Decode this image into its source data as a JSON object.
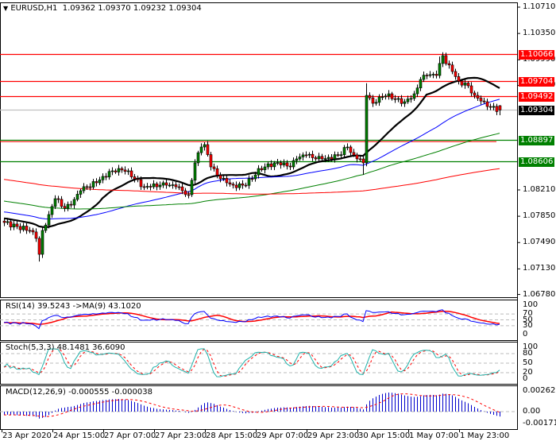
{
  "header": {
    "arrow": "▼",
    "symbol": "EURUSD,H1",
    "open": "1.09362",
    "high": "1.09370",
    "low": "1.09232",
    "close": "1.09304"
  },
  "chart_data": {
    "type": "candlestick",
    "symbol": "EURUSD",
    "timeframe": "H1",
    "last_bar": {
      "open": 1.09362,
      "high": 1.0937,
      "low": 1.09232,
      "close": 1.09304
    },
    "close_keypoints": [
      [
        0,
        1.07764
      ],
      [
        4,
        1.0771
      ],
      [
        8,
        1.07656
      ],
      [
        10,
        1.07547
      ],
      [
        11,
        1.07329
      ],
      [
        12,
        1.07656
      ],
      [
        14,
        1.07873
      ],
      [
        16,
        1.0809
      ],
      [
        19,
        1.0796
      ],
      [
        21,
        1.08003
      ],
      [
        24,
        1.08199
      ],
      [
        26,
        1.08253
      ],
      [
        29,
        1.08308
      ],
      [
        31,
        1.08395
      ],
      [
        34,
        1.08471
      ],
      [
        36,
        1.08503
      ],
      [
        39,
        1.08471
      ],
      [
        41,
        1.08362
      ],
      [
        44,
        1.08253
      ],
      [
        46,
        1.08253
      ],
      [
        49,
        1.08275
      ],
      [
        51,
        1.08275
      ],
      [
        54,
        1.08253
      ],
      [
        56,
        1.08199
      ],
      [
        58,
        1.08145
      ],
      [
        60,
        1.0858
      ],
      [
        62,
        1.08797
      ],
      [
        63,
        1.0883
      ],
      [
        65,
        1.08525
      ],
      [
        68,
        1.08362
      ],
      [
        70,
        1.08308
      ],
      [
        72,
        1.08275
      ],
      [
        75,
        1.08275
      ],
      [
        78,
        1.08362
      ],
      [
        80,
        1.08503
      ],
      [
        82,
        1.08525
      ],
      [
        85,
        1.0858
      ],
      [
        88,
        1.0858
      ],
      [
        90,
        1.08525
      ],
      [
        92,
        1.08634
      ],
      [
        95,
        1.08688
      ],
      [
        98,
        1.08634
      ],
      [
        100,
        1.08634
      ],
      [
        102,
        1.08656
      ],
      [
        105,
        1.08688
      ],
      [
        108,
        1.08797
      ],
      [
        110,
        1.08688
      ],
      [
        112,
        1.08634
      ],
      [
        113,
        1.0858
      ],
      [
        114,
        1.09503
      ],
      [
        116,
        1.09395
      ],
      [
        118,
        1.09482
      ],
      [
        121,
        1.09525
      ],
      [
        123,
        1.09449
      ],
      [
        126,
        1.09416
      ],
      [
        129,
        1.09525
      ],
      [
        131,
        1.09721
      ],
      [
        133,
        1.09775
      ],
      [
        136,
        1.09775
      ],
      [
        138,
        1.10047
      ],
      [
        139,
        1.09938
      ],
      [
        141,
        1.0983
      ],
      [
        143,
        1.09699
      ],
      [
        146,
        1.09634
      ],
      [
        148,
        1.09503
      ],
      [
        151,
        1.09416
      ],
      [
        153,
        1.0934
      ],
      [
        156,
        1.09304
      ]
    ],
    "moving_averages": [
      {
        "name": "MA20",
        "period": 20,
        "color": "#000000"
      },
      {
        "name": "MA50",
        "period": 50,
        "color": "#0000ff"
      },
      {
        "name": "MA100",
        "period": 100,
        "color": "#008000"
      },
      {
        "name": "MA200",
        "period": 200,
        "color": "#ff0000"
      }
    ],
    "levels": [
      {
        "label": "1.10066",
        "value": 1.10066,
        "color": "#ff0000"
      },
      {
        "label": "1.09704",
        "value": 1.09704,
        "color": "#ff0000"
      },
      {
        "label": "1.09492",
        "value": 1.09492,
        "color": "#ff0000"
      },
      {
        "label": "1.09304",
        "value": 1.09304,
        "color": "#000000",
        "line_color": "#c0c0c0"
      },
      {
        "label": "1.08897",
        "value": 1.08897,
        "color": "#008000"
      },
      {
        "label": "1.08606",
        "value": 1.08606,
        "color": "#008000"
      }
    ],
    "y_ticks": [
      "1.10710",
      "1.10350",
      "1.09990",
      "1.09640",
      "1.08210",
      "1.07850",
      "1.07490",
      "1.07130",
      "1.06780"
    ],
    "x_ticks": [
      "23 Apr 2020",
      "24 Apr 15:00",
      "27 Apr 07:00",
      "27 Apr 23:00",
      "28 Apr 15:00",
      "29 Apr 07:00",
      "29 Apr 23:00",
      "30 Apr 15:00",
      "1 May 07:00",
      "1 May 23:00"
    ],
    "ylim": [
      1.0678,
      1.1071
    ]
  },
  "rsi": {
    "title": "RSI(14) 39.5243  ->MA(9) 43.1020",
    "ticks": [
      "100",
      "70",
      "50",
      "30",
      "0"
    ]
  },
  "stoch": {
    "title": "Stoch(5,3,3) 48.1481 36.6090",
    "ticks": [
      "100",
      "80",
      "50",
      "20",
      "0"
    ]
  },
  "macd": {
    "title": "MACD(12,26,9) -0.000555 -0.000038",
    "ticks": [
      "0.002627",
      "0.00",
      "-0.001716"
    ]
  }
}
